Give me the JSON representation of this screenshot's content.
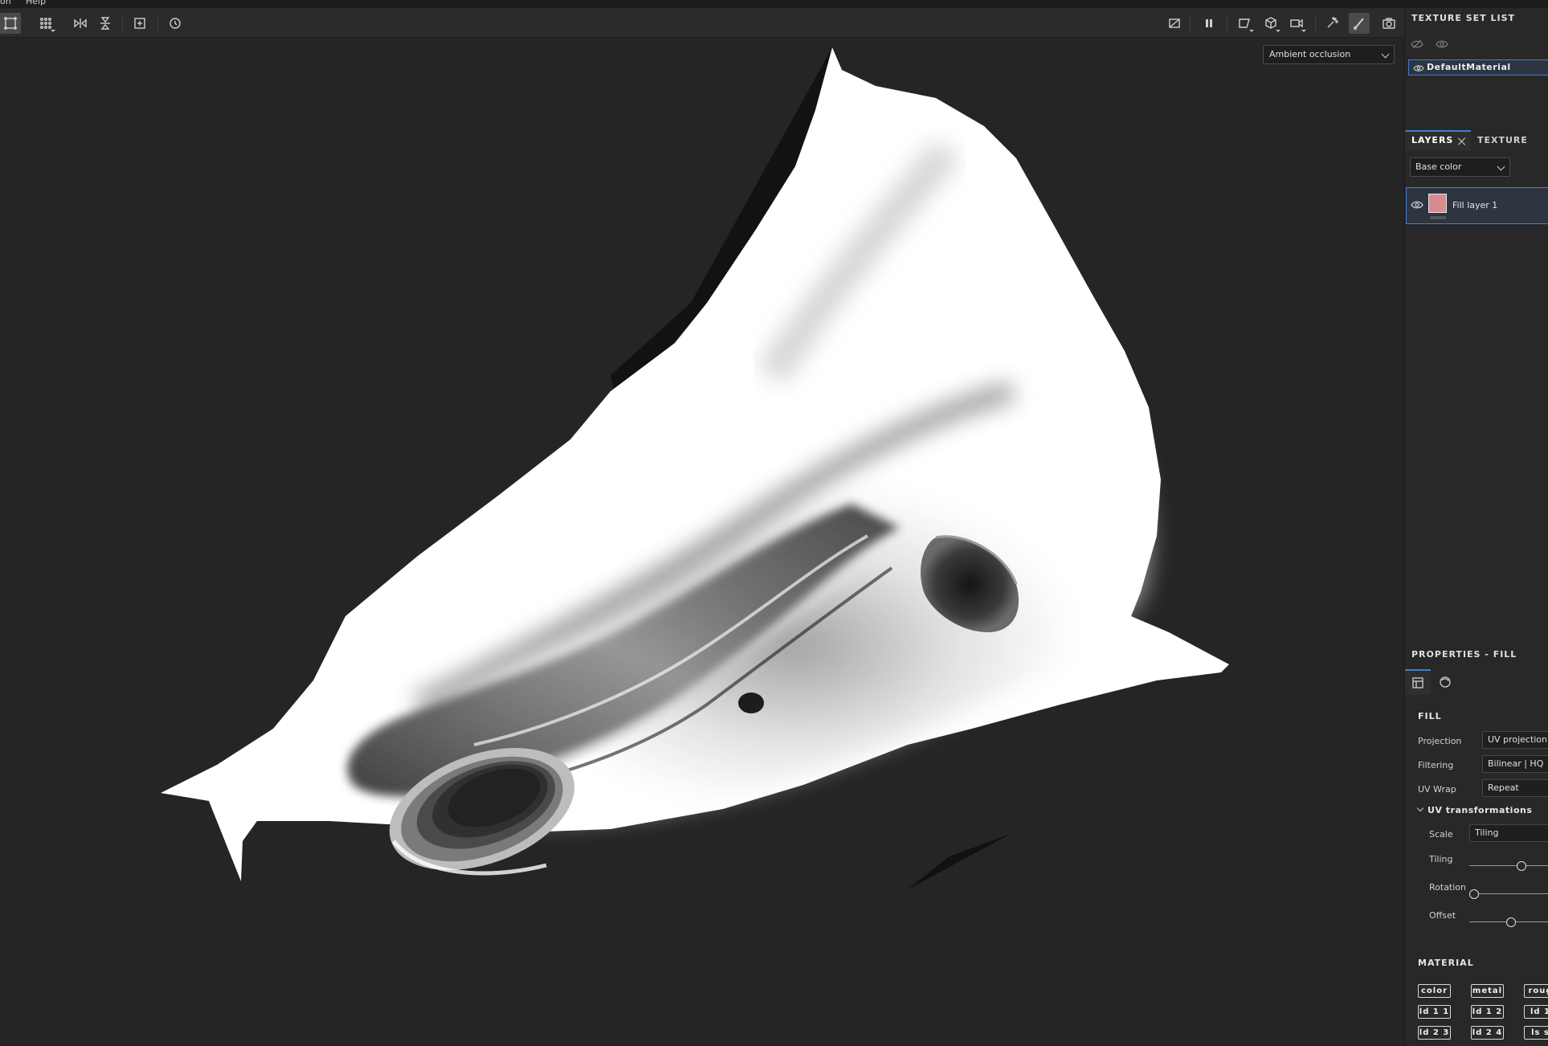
{
  "menubar": {
    "items": [
      "on",
      "Help"
    ]
  },
  "viewport": {
    "channel_display": "Ambient occlusion"
  },
  "texture_set_list": {
    "title": "TEXTURE SET LIST",
    "materials": [
      "DefaultMaterial"
    ]
  },
  "layers_panel": {
    "tabs": [
      "LAYERS",
      "TEXTURE SET S"
    ],
    "channel": "Base color",
    "layers": [
      {
        "name": "Fill layer 1",
        "color": "#d88a8f"
      }
    ]
  },
  "properties": {
    "title": "PROPERTIES - FILL",
    "fill": {
      "title": "FILL",
      "projection": {
        "label": "Projection",
        "value": "UV projection"
      },
      "filtering": {
        "label": "Filtering",
        "value": "Bilinear | HQ"
      },
      "uv_wrap": {
        "label": "UV Wrap",
        "value": "Repeat"
      }
    },
    "uv_transformations": {
      "title": "UV transformations",
      "scale": {
        "label": "Scale",
        "value": "Tiling"
      },
      "tiling": {
        "label": "Tiling",
        "level": 0.6
      },
      "rotation": {
        "label": "Rotation",
        "level": 0.0
      },
      "offset": {
        "label": "Offset",
        "level": 0.47
      }
    },
    "material": {
      "title": "MATERIAL",
      "chips": [
        "color",
        "metal",
        "roug",
        "ld 1 1",
        "ld 1 2",
        "ld 1",
        "ld 2 3",
        "ld 2 4",
        "ls s"
      ]
    }
  },
  "colors": {
    "accent": "#3d7fd1",
    "panel": "#282828",
    "viewport": "#252525"
  }
}
